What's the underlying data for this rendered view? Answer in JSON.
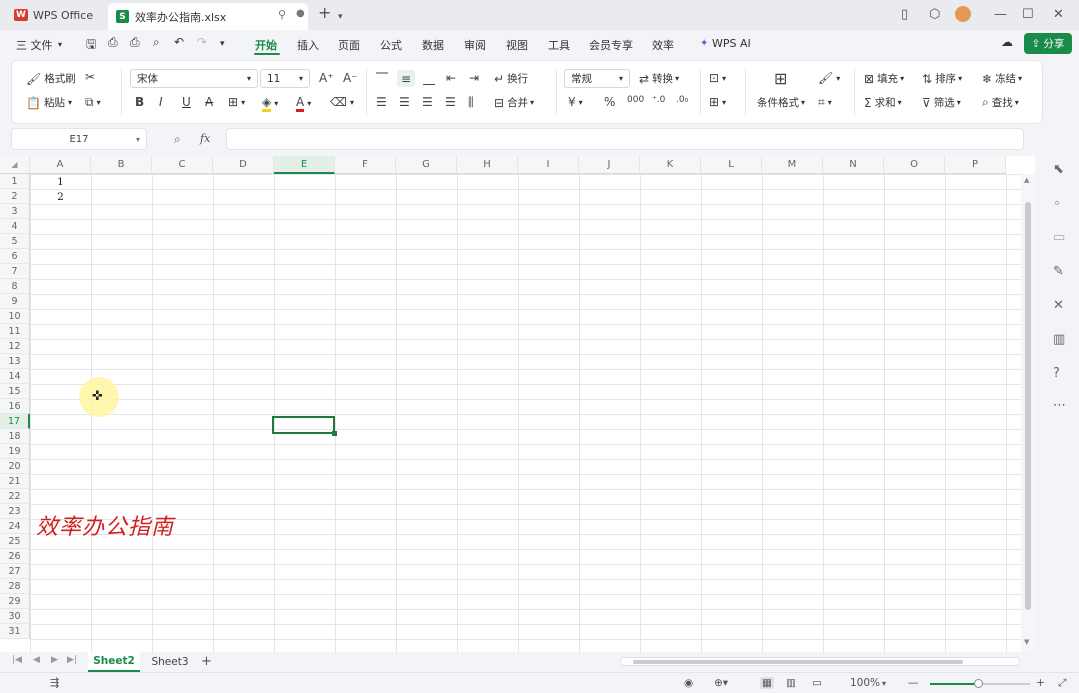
{
  "titlebar": {
    "home_tab": "WPS Office",
    "file_tab": "效率办公指南.xlsx",
    "new_tab": "+"
  },
  "menubar": {
    "file_menu": "三 文件",
    "items": [
      "开始",
      "插入",
      "页面",
      "公式",
      "数据",
      "审阅",
      "视图",
      "工具",
      "会员专享",
      "效率"
    ],
    "ai": "WPS AI",
    "share": "分享"
  },
  "ribbon": {
    "format_painter": "格式刷",
    "paste": "粘贴",
    "font_name": "宋体",
    "font_size": "11",
    "wrap": "换行",
    "merge": "合并",
    "number_format": "常规",
    "convert": "转换",
    "cond_format": "条件格式",
    "fill": "填充",
    "sort": "排序",
    "freeze": "冻结",
    "sum": "求和",
    "filter": "筛选",
    "find": "查找"
  },
  "formulabar": {
    "namebox": "E17",
    "fx": "fx",
    "content": ""
  },
  "grid": {
    "columns": [
      "A",
      "B",
      "C",
      "D",
      "E",
      "F",
      "G",
      "H",
      "I",
      "J",
      "K",
      "L",
      "M",
      "N",
      "O",
      "P"
    ],
    "selected_column": "E",
    "rows": [
      "1",
      "2",
      "3",
      "4",
      "5",
      "6",
      "7",
      "8",
      "9",
      "10",
      "11",
      "12",
      "13",
      "14",
      "15",
      "16",
      "17",
      "18",
      "19",
      "20",
      "21",
      "22",
      "23",
      "24",
      "25",
      "26",
      "27",
      "28",
      "29",
      "30",
      "31"
    ],
    "selected_row": "17",
    "cells": {
      "A1": "1",
      "A2": "2"
    },
    "overlay_text": "效率办公指南"
  },
  "sheets": {
    "tabs": [
      "Sheet2",
      "Sheet3"
    ],
    "active": "Sheet2",
    "add": "+"
  },
  "statusbar": {
    "zoom": "100%"
  },
  "colors": {
    "accent": "#1a8b4a",
    "selection": "#1f7a3e",
    "overlay_text": "#d02020",
    "brand_red": "#d83b32"
  }
}
